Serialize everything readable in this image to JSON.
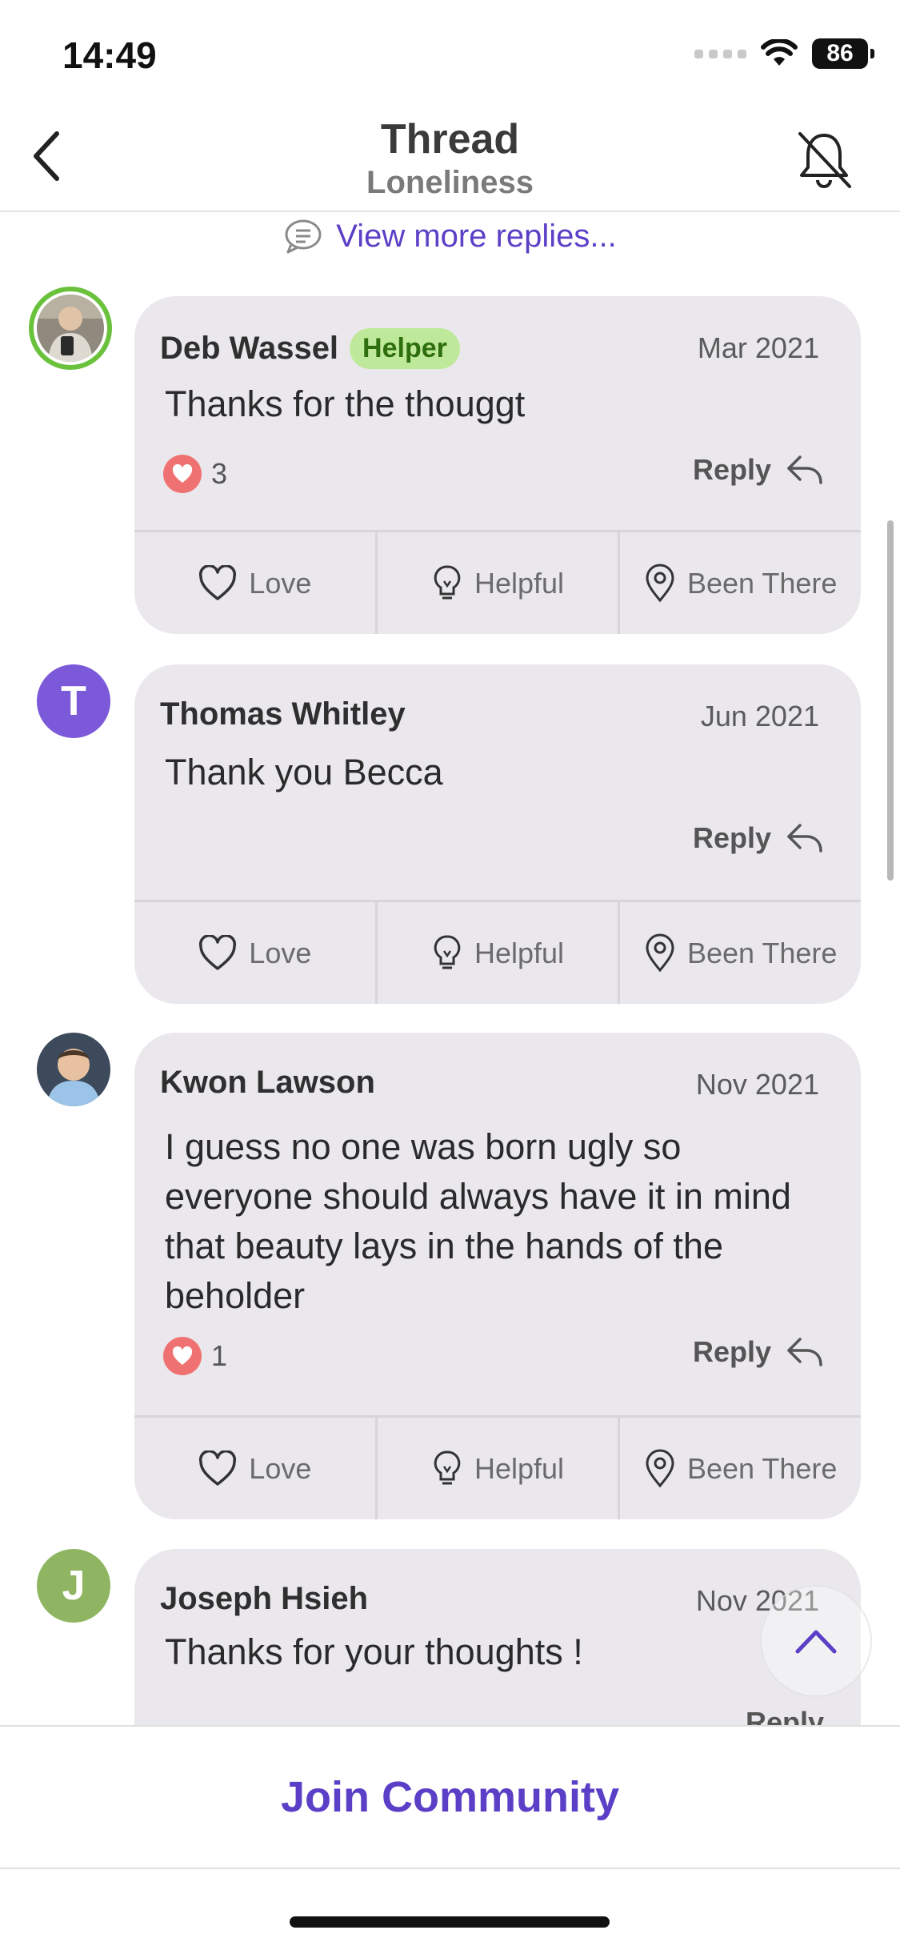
{
  "status_bar": {
    "time": "14:49",
    "battery": "86"
  },
  "header": {
    "title": "Thread",
    "subtitle": "Loneliness"
  },
  "view_more": {
    "label": "View more replies..."
  },
  "actions": {
    "love": "Love",
    "helpful": "Helpful",
    "been_there": "Been There",
    "reply": "Reply"
  },
  "comments": [
    {
      "name": "Deb Wassel",
      "badge": "Helper",
      "date": "Mar 2021",
      "text": "Thanks for the thouggt",
      "likes": "3",
      "avatar": "photo"
    },
    {
      "name": "Thomas Whitley",
      "date": "Jun 2021",
      "text": "Thank you Becca",
      "avatar_letter": "T",
      "avatar_color": "#7b59d9"
    },
    {
      "name": "Kwon Lawson",
      "date": "Nov 2021",
      "text": "I guess no one was born ugly so everyone should always have it in mind that beauty lays in the hands of the beholder",
      "likes": "1",
      "avatar": "photo"
    },
    {
      "name": "Joseph Hsieh",
      "date": "Nov 2021",
      "text": "Thanks for your thoughts !",
      "avatar_letter": "J",
      "avatar_color": "#8fb562"
    }
  ],
  "footer": {
    "join_label": "Join Community"
  },
  "colors": {
    "accent": "#5b3fc7",
    "helper_badge": "#bfe99a",
    "heart": "#f07171",
    "bubble": "#eae8ec"
  },
  "icons": [
    "chevron-left-icon",
    "bell-off-icon",
    "chat-bubble-icon",
    "heart-icon",
    "lightbulb-icon",
    "location-pin-icon",
    "reply-arrow-icon",
    "chevron-up-icon",
    "wifi-icon",
    "battery-icon"
  ]
}
